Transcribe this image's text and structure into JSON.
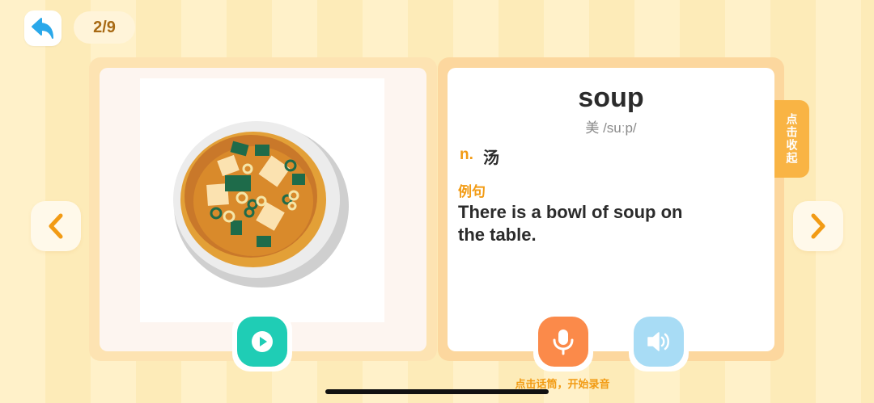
{
  "header": {
    "back_icon": "back-arrow-icon",
    "counter": "2/9"
  },
  "picture": {
    "icon": "soup-bowl-illustration"
  },
  "word_card": {
    "word": "soup",
    "phonetic": "美 /suːp/",
    "part_of_speech": "n.",
    "meaning": "汤",
    "example_label": "例句",
    "example_sentence": "There is a bowl of soup on the table."
  },
  "collect_tab": {
    "label": "点击收起"
  },
  "controls": {
    "prev_icon": "chevron-left-icon",
    "next_icon": "chevron-right-icon",
    "play_icon": "play-icon",
    "mic_icon": "microphone-icon",
    "speaker_icon": "speaker-icon",
    "mic_hint": "点击话筒，开始录音"
  },
  "colors": {
    "accent_orange": "#f29b14",
    "play_teal": "#1fcdb5",
    "mic_orange": "#fb8a4a",
    "speaker_blue": "#a8dcf5",
    "back_blue": "#2aa8ea"
  }
}
